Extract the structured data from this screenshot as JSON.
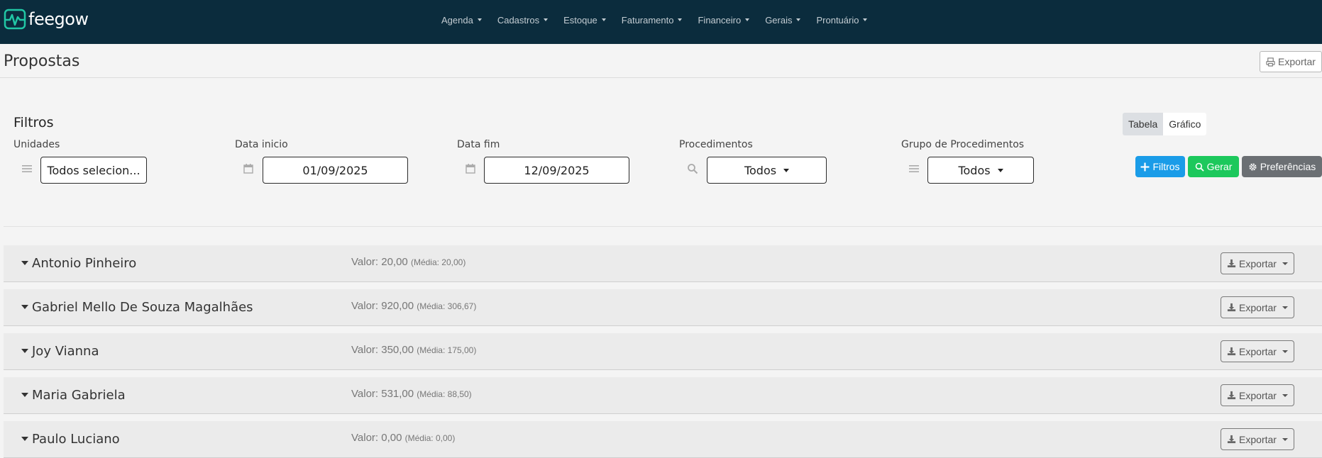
{
  "app": {
    "logo_text": "feegow",
    "brand_color": "#0b2c3d",
    "logo_color": "#21c7a5"
  },
  "nav": {
    "items": [
      {
        "label": "Agenda"
      },
      {
        "label": "Cadastros"
      },
      {
        "label": "Estoque"
      },
      {
        "label": "Faturamento"
      },
      {
        "label": "Financeiro"
      },
      {
        "label": "Gerais"
      },
      {
        "label": "Prontuário"
      }
    ]
  },
  "header": {
    "title": "Propostas",
    "export_label": "Exportar"
  },
  "filters": {
    "title": "Filtros",
    "unidades": {
      "label": "Unidades",
      "value": "Todos selecion..."
    },
    "data_inicio": {
      "label": "Data inicio",
      "value": "01/09/2025"
    },
    "data_fim": {
      "label": "Data fim",
      "value": "12/09/2025"
    },
    "procedimentos": {
      "label": "Procedimentos",
      "value": "Todos"
    },
    "grupo": {
      "label": "Grupo de Procedimentos",
      "value": "Todos"
    }
  },
  "view_toggle": {
    "tabela": "Tabela",
    "grafico": "Gráfico",
    "active": "Tabela"
  },
  "actions": {
    "filtros": "Filtros",
    "gerar": "Gerar",
    "preferencias": "Preferências",
    "colors": {
      "filtros": "#1a9ce8",
      "gerar": "#1cc85c",
      "preferencias": "#6b6f73"
    }
  },
  "results": [
    {
      "name": "Antonio Pinheiro",
      "valor": "Valor: 20,00",
      "media": "(Média: 20,00)",
      "export": "Exportar"
    },
    {
      "name": "Gabriel Mello De Souza Magalhães",
      "valor": "Valor: 920,00",
      "media": "(Média: 306,67)",
      "export": "Exportar"
    },
    {
      "name": "Joy Vianna",
      "valor": "Valor: 350,00",
      "media": "(Média: 175,00)",
      "export": "Exportar"
    },
    {
      "name": "Maria Gabriela",
      "valor": "Valor: 531,00",
      "media": "(Média: 88,50)",
      "export": "Exportar"
    },
    {
      "name": "Paulo Luciano",
      "valor": "Valor: 0,00",
      "media": "(Média: 0,00)",
      "export": "Exportar"
    }
  ]
}
